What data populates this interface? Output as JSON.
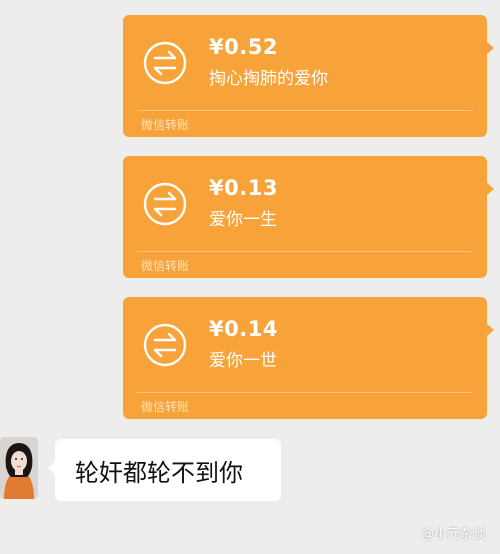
{
  "transfers": [
    {
      "amount": "¥0.52",
      "memo": "掏心掏肺的爱你",
      "footer": "微信转账"
    },
    {
      "amount": "¥0.13",
      "memo": "爱你一生",
      "footer": "微信转账"
    },
    {
      "amount": "¥0.14",
      "memo": "爱你一世",
      "footer": "微信转账"
    }
  ],
  "reply": {
    "text": "轮奸都轮不到你"
  },
  "watermark": {
    "text": "@小元杂谈"
  },
  "colors": {
    "transfer_bg": "#f7a33a",
    "chat_bg": "#ededed",
    "bubble_bg": "#ffffff"
  },
  "icons": {
    "transfer": "transfer-arrows-icon",
    "avatar": "avatar"
  }
}
